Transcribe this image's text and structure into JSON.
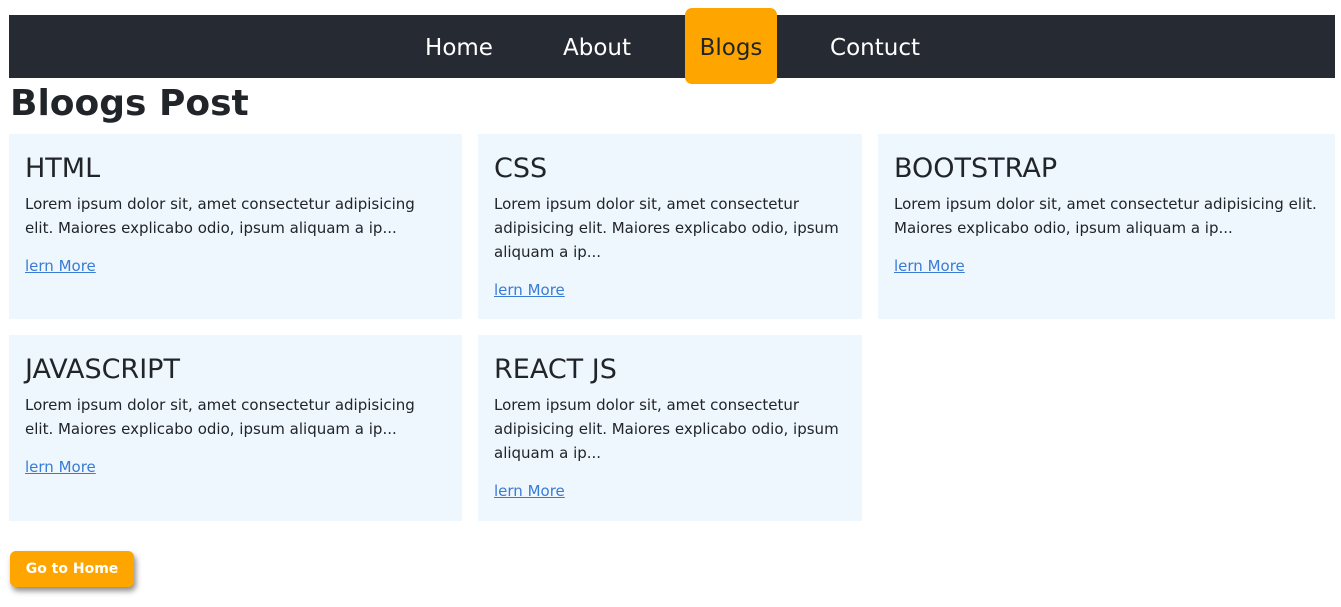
{
  "nav": {
    "items": [
      {
        "label": "Home"
      },
      {
        "label": "About"
      },
      {
        "label": "Blogs"
      },
      {
        "label": "Contuct"
      }
    ]
  },
  "page": {
    "title": "Bloogs Post"
  },
  "cards": [
    {
      "title": "HTML",
      "text": "Lorem ipsum dolor sit, amet consectetur adipisicing elit. Maiores explicabo odio, ipsum aliquam a ip...",
      "link": "lern More"
    },
    {
      "title": "CSS",
      "text": "Lorem ipsum dolor sit, amet consectetur adipisicing elit. Maiores explicabo odio, ipsum aliquam a ip...",
      "link": "lern More"
    },
    {
      "title": "BOOTSTRAP",
      "text": "Lorem ipsum dolor sit, amet consectetur adipisicing elit. Maiores explicabo odio, ipsum aliquam a ip...",
      "link": "lern More"
    },
    {
      "title": "JAVASCRIPT",
      "text": "Lorem ipsum dolor sit, amet consectetur adipisicing elit. Maiores explicabo odio, ipsum aliquam a ip...",
      "link": "lern More"
    },
    {
      "title": "REACT JS",
      "text": "Lorem ipsum dolor sit, amet consectetur adipisicing elit. Maiores explicabo odio, ipsum aliquam a ip...",
      "link": "lern More"
    }
  ],
  "footer": {
    "home_button_label": "Go to Home"
  },
  "colors": {
    "navbar": "#262a33",
    "accent": "#ffa500",
    "card_bg": "#eef7fd",
    "link": "#3a7bd5"
  }
}
